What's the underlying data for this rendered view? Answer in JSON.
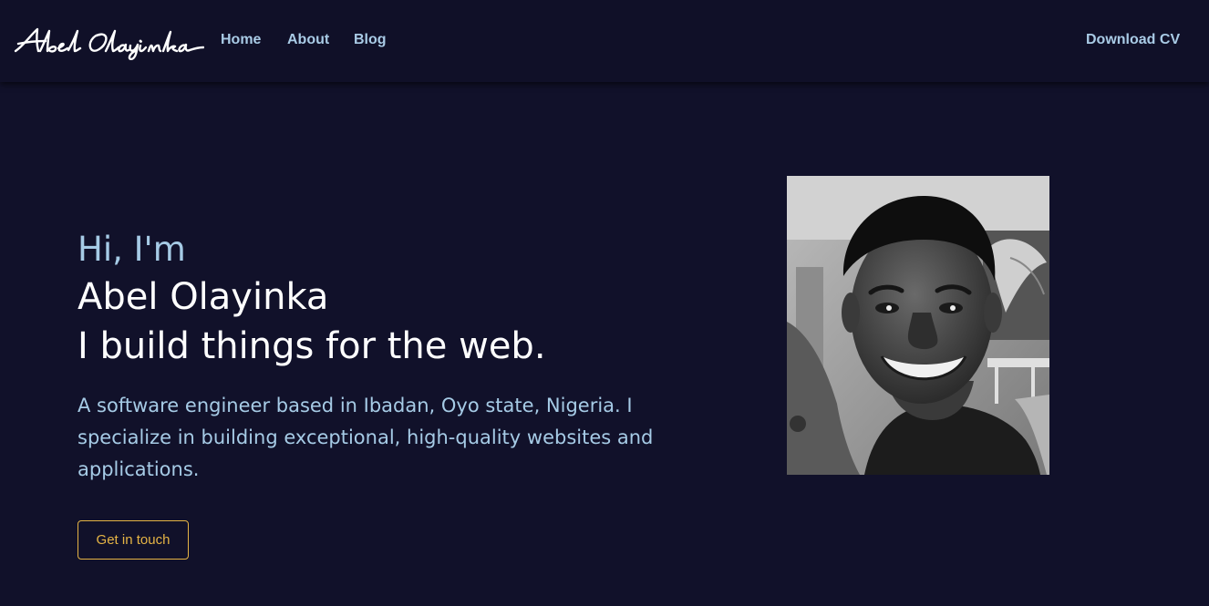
{
  "nav": {
    "logo_text": "Abel Olayinka",
    "links": [
      "Home",
      "About",
      "Blog"
    ],
    "download_cv": "Download CV"
  },
  "hero": {
    "greeting": "Hi, I'm",
    "name": "Abel Olayinka",
    "tagline": "I build things for the web.",
    "description": "A software engineer based in Ibadan, Oyo state, Nigeria. I specialize in building exceptional, high-quality websites and applications.",
    "cta_label": "Get in touch"
  },
  "colors": {
    "background": "#11112a",
    "navbar": "#101028",
    "accent_blue": "#a6cbe6",
    "accent_gold": "#e5b445",
    "heading_white": "#ffffff"
  },
  "images": {
    "portrait": "black-and-white-portrait-photo"
  }
}
